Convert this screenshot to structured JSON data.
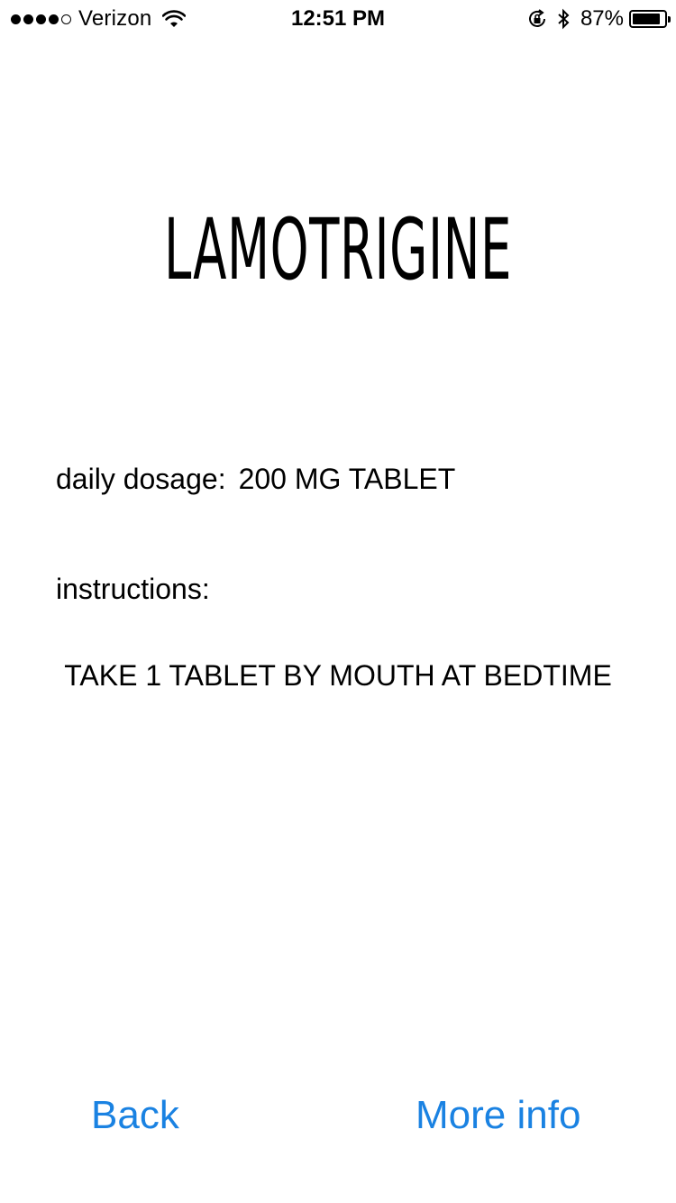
{
  "status_bar": {
    "carrier": "Verizon",
    "signal_bars_filled": 4,
    "signal_bars_total": 5,
    "time": "12:51 PM",
    "battery_percent": "87%",
    "battery_level": 0.87,
    "icons": [
      "wifi-icon",
      "rotation-lock-icon",
      "bluetooth-icon",
      "battery-icon"
    ]
  },
  "drug": {
    "name": "LAMOTRIGINE"
  },
  "dosage": {
    "label": "daily dosage:",
    "value": "200 MG TABLET"
  },
  "instructions": {
    "label": "instructions:",
    "text": "TAKE 1 TABLET BY MOUTH AT BEDTIME"
  },
  "buttons": {
    "back_label": "Back",
    "more_info_label": "More info"
  },
  "colors": {
    "accent": "#1a82e2",
    "text": "#000000",
    "background": "#ffffff"
  }
}
